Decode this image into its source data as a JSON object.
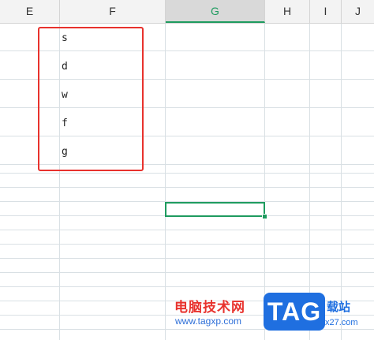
{
  "columns": [
    "E",
    "F",
    "G",
    "H",
    "I",
    "J"
  ],
  "selected_column": "G",
  "cells": {
    "F": [
      "s",
      "d",
      "w",
      "f",
      "g"
    ]
  },
  "watermark": {
    "text_cn": "电脑技术网",
    "url": "www.tagxp.com",
    "badge": "TAG",
    "tail_cn": "载站",
    "tail_url": "x27.com"
  },
  "colors": {
    "accent_green": "#1e9b5f",
    "highlight_red": "#e8322d",
    "watermark_blue": "#1f6fe0"
  }
}
